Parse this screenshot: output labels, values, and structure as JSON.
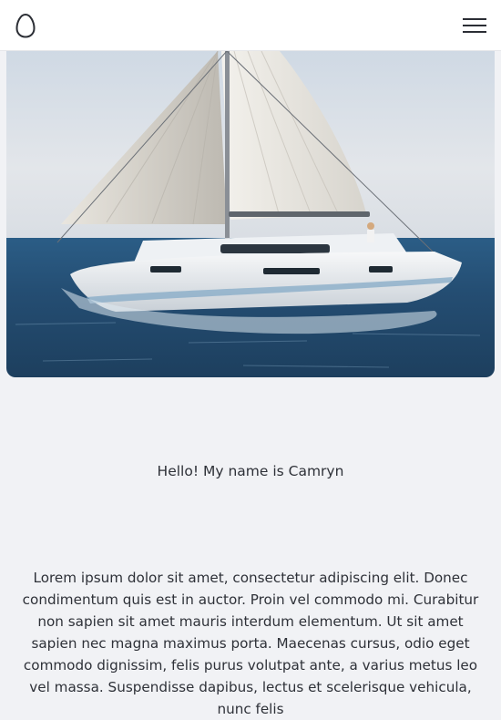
{
  "header": {
    "logo_icon": "egg-logo-icon",
    "menu_icon": "hamburger-menu-icon"
  },
  "hero": {
    "image_subject": "sailboat-photo"
  },
  "greeting": "Hello! My name is Camryn",
  "bio": "Lorem ipsum dolor sit amet, consectetur adipiscing elit. Donec condimentum quis est in auctor. Proin vel commodo mi. Curabitur non sapien sit amet mauris interdum elementum. Ut sit amet sapien nec magna maximus porta. Maecenas cursus, odio eget commodo dignissim, felis purus volutpat ante, a varius metus leo vel massa. Suspendisse dapibus, lectus et scelerisque vehicula, nunc felis",
  "colors": {
    "background": "#f1f2f5",
    "text": "#2e3138",
    "header": "#ffffff"
  }
}
